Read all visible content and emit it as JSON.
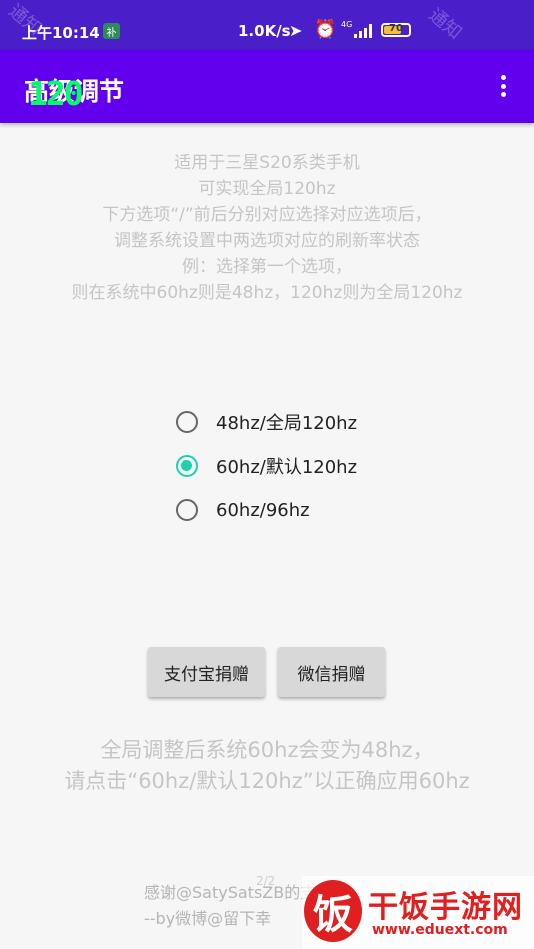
{
  "status_bar": {
    "time": "上午10:14",
    "sim_badge": "补",
    "speed": "1.0K/s",
    "network": "4G",
    "battery_level": "70",
    "battery_color": "#f1c232",
    "watermark": "通知"
  },
  "app_bar": {
    "title": "高级调节",
    "overlay_badge": "120",
    "menu_icon": "more-vert-icon",
    "color": "#6200ee"
  },
  "description": {
    "lines": [
      "适用于三星S20系类手机",
      "可实现全局120hz",
      "下方选项“/”前后分别对应选择对应选项后，",
      "调整系统设置中两选项对应的刷新率状态",
      "例：选择第一个选项，",
      "则在系统中60hz则是48hz，120hz则为全局120hz"
    ]
  },
  "refresh_options": {
    "selected_index": 1,
    "accent_color": "#1dd0b0",
    "items": [
      {
        "label": "48hz/全局120hz",
        "checked": false
      },
      {
        "label": "60hz/默认120hz",
        "checked": true
      },
      {
        "label": "60hz/96hz",
        "checked": false
      }
    ]
  },
  "buttons": {
    "alipay": "支付宝捐赠",
    "wechat": "微信捐赠"
  },
  "note": {
    "line1": "全局调整后系统60hz会变为48hz，",
    "line2": "请点击“60hz/默认120hz”以正确应用60hz"
  },
  "footer": {
    "page_indicator": "2/2",
    "line1": "感谢@SatySatsZB的支持",
    "line2": "--by微博@留下幸"
  },
  "site_watermark": {
    "mark": "饭",
    "name": "干饭手游网",
    "url": "www.eduext.com"
  }
}
